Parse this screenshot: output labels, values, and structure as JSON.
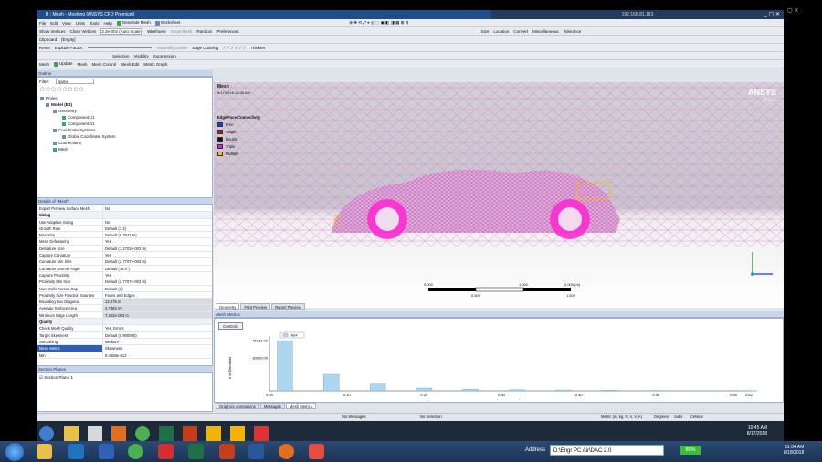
{
  "window_title": "B : Mesh - Meshing [ANSYS CFD Premium]",
  "rdp_ip": "192.168.81.183",
  "menu": [
    "File",
    "Edit",
    "View",
    "Units",
    "Tools",
    "Help",
    "Generate Mesh",
    "Worksheet"
  ],
  "toolbar2": [
    "Show Vertices",
    "Close Vertices",
    "3.3e-002 (Auto Scale)",
    "Wireframe",
    "Show Mesh",
    "Random",
    "Preferences",
    "Size",
    "Location",
    "Convert",
    "Miscellaneous",
    "Tolerance"
  ],
  "toolbar3": [
    "Clipboard",
    "[Empty]"
  ],
  "toolbar4": [
    "Reset",
    "Explode Factor:",
    "Assembly Center",
    "Edge Coloring",
    "Thicken"
  ],
  "toolbar5": [
    "Selection",
    "Visibility",
    "Suppression"
  ],
  "toolbar6": [
    "Mesh",
    "Update",
    "Mesh",
    "Mesh Control",
    "Mesh Edit",
    "Metric Graph"
  ],
  "outline": {
    "title": "Outline",
    "filter_label": "Filter:",
    "filter_value": "Name",
    "items": [
      "Project",
      "Model (B3)",
      "Geometry",
      "Component1\\1",
      "Component2\\1",
      "Coordinate Systems",
      "Global Coordinate System",
      "Connections",
      "Mesh"
    ]
  },
  "details": {
    "title": "Details of \"Mesh\"",
    "rows": [
      {
        "k": "Export Preview Surface Mesh",
        "v": "No"
      },
      {
        "k": "Sizing",
        "v": "",
        "sec": true
      },
      {
        "k": "Use Adaptive Sizing",
        "v": "No"
      },
      {
        "k": "Growth Rate",
        "v": "Default (1.2)"
      },
      {
        "k": "Max Size",
        "v": "Default (0.2541 m)"
      },
      {
        "k": "Mesh Defeaturing",
        "v": "Yes"
      },
      {
        "k": "Defeature Size",
        "v": "Default (1.2703e-003 m)"
      },
      {
        "k": "Capture Curvature",
        "v": "Yes"
      },
      {
        "k": "Curvature Min Size",
        "v": "Default (2.7707e-003 m)"
      },
      {
        "k": "Curvature Normal Angle",
        "v": "Default (18.0°)"
      },
      {
        "k": "Capture Proximity",
        "v": "Yes"
      },
      {
        "k": "Proximity Min Size",
        "v": "Default (2.7707e-003 m)"
      },
      {
        "k": "Num Cells Across Gap",
        "v": "Default (3)"
      },
      {
        "k": "Proximity Size Function Sources",
        "v": "Faces and Edges"
      },
      {
        "k": "Bounding Box Diagonal",
        "v": "12.575 m",
        "gray": true
      },
      {
        "k": "Average Surface Area",
        "v": "2.7482 m²",
        "gray": true
      },
      {
        "k": "Minimum Edge Length",
        "v": "7.252e-003 m",
        "gray": true
      },
      {
        "k": "Quality",
        "v": "",
        "sec": true
      },
      {
        "k": "Check Mesh Quality",
        "v": "Yes, Errors"
      },
      {
        "k": "Target Skewness",
        "v": "Default (0.900000)"
      },
      {
        "k": "Smoothing",
        "v": "Medium"
      },
      {
        "k": "Mesh Metric",
        "v": "Skewness",
        "hl": true
      },
      {
        "k": "Min",
        "v": "9.4459e-012"
      }
    ]
  },
  "section_planes": {
    "title": "Section Planes",
    "item": "Section Plane 1"
  },
  "viewport": {
    "label": "Mesh",
    "date": "8/17/2018 10:38 AM",
    "brand": "ANSYS",
    "version": "R19.1",
    "legend_title": "Edge/Face Connectivity",
    "legend": [
      {
        "label": "Free",
        "color": "#1b3bd8"
      },
      {
        "label": "Single",
        "color": "#c91818"
      },
      {
        "label": "Double",
        "color": "#111111"
      },
      {
        "label": "Triple",
        "color": "#e01adf"
      },
      {
        "label": "Multiple",
        "color": "#f2c200"
      }
    ],
    "scale_labels": [
      "0.000",
      "1.000",
      "2.000 (m)",
      "0.500",
      "1.500"
    ],
    "tabs": [
      "Geometry",
      "Print Preview",
      "Report Preview"
    ]
  },
  "mesh_metrics": {
    "title": "Mesh Metrics",
    "controls_label": "Controls",
    "legend": "Tet4",
    "ylabel": "# of Elements",
    "xlabel": "Element Metrics",
    "tabs": [
      "Graphics Annotations",
      "Messages",
      "Mesh Metrics"
    ]
  },
  "chart_data": {
    "type": "bar",
    "x": [
      0.02,
      0.08,
      0.14,
      0.2,
      0.26,
      0.32,
      0.38,
      0.44,
      0.5,
      0.56,
      0.62
    ],
    "values": [
      45731,
      15000,
      6000,
      2500,
      1500,
      1000,
      800,
      600,
      400,
      300,
      200
    ],
    "yticks": [
      "45731.00",
      "30000.00"
    ],
    "xticks": [
      "0.00",
      "0.10",
      "0.20",
      "0.30",
      "0.40",
      "0.50",
      "0.60",
      "0.62"
    ],
    "series": [
      {
        "name": "Tet4"
      }
    ]
  },
  "status": {
    "messages": "No Messages",
    "selection": "No Selection",
    "units": "Metric (m, kg, N, s, V, A)",
    "degrees": "Degrees",
    "rad": "rad/s",
    "celsius": "Celsius"
  },
  "clock": {
    "time": "10:45 AM",
    "date": "8/17/2018",
    "time2": "11:04 AM",
    "date2": "8/18/2018"
  },
  "address": {
    "label": "Address",
    "value": "D:\\Engr PC Air\\DAC 2.0",
    "battery": "88%"
  }
}
